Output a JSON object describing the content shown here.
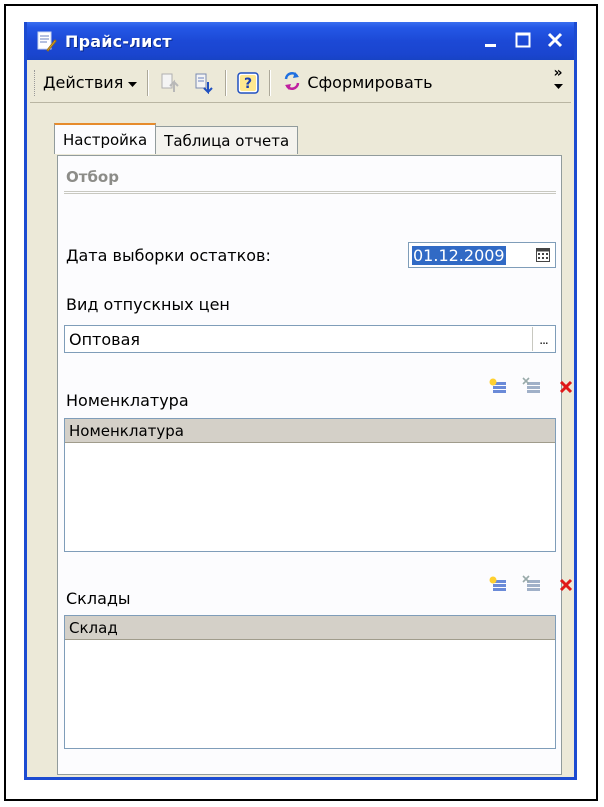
{
  "window": {
    "title": "Прайс-лист"
  },
  "toolbar": {
    "actions_label": "Действия",
    "generate_label": "Сформировать",
    "help_label": "?",
    "overflow_label": "»"
  },
  "tabs": [
    {
      "label": "Настройка",
      "active": true
    },
    {
      "label": "Таблица отчета",
      "active": false
    }
  ],
  "settings": {
    "group_title": "Отбор",
    "date_label": "Дата выборки остатков:",
    "date_value": "01.12.2009",
    "price_type_label": "Вид отпускных цен",
    "price_type_value": "Оптовая",
    "dots_label": "...",
    "nomenclature_label": "Номенклатура",
    "nomenclature_column": "Номенклатура",
    "warehouses_label": "Склады",
    "warehouses_column": "Склад"
  },
  "colors": {
    "title_bar": "#1c49d6",
    "selection": "#316ac5",
    "delete": "#e01818",
    "tab_accent": "#e68b2c"
  }
}
